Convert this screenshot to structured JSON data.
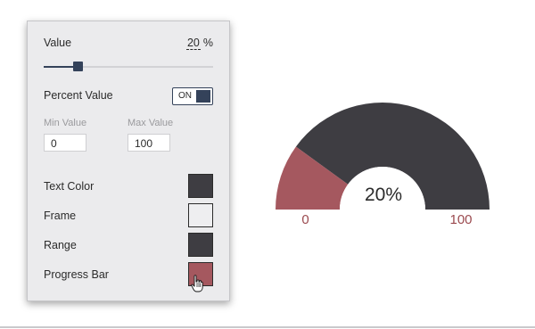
{
  "panel": {
    "value_label": "Value",
    "value": "20",
    "value_unit": "%",
    "slider_fraction": 0.2,
    "percent_value_label": "Percent Value",
    "toggle_label": "ON",
    "min_label": "Min Value",
    "min_value": "0",
    "max_label": "Max Value",
    "max_value": "100",
    "colors": [
      {
        "label": "Text Color",
        "color": "#3e3d42"
      },
      {
        "label": "Frame",
        "color": "#eeeef0"
      },
      {
        "label": "Range",
        "color": "#3e3d42"
      },
      {
        "label": "Progress Bar",
        "color": "#a5585f"
      }
    ]
  },
  "gauge": {
    "value_text": "20%",
    "progress": 0.2,
    "min_text": "0",
    "max_text": "100",
    "range_color": "#3e3d42",
    "progress_color": "#a5585f",
    "frame_color": "#ffffff"
  }
}
